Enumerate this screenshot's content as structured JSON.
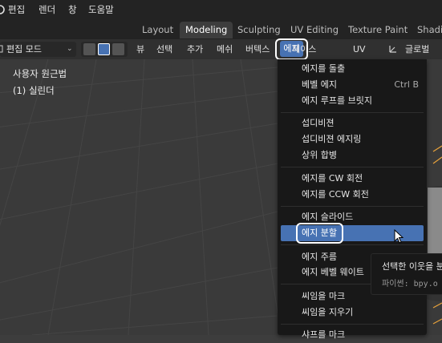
{
  "top_menu": {
    "items": [
      "편집",
      "렌더",
      "창",
      "도움말"
    ]
  },
  "workspaces": {
    "tabs": [
      {
        "label": "Layout",
        "active": false
      },
      {
        "label": "Modeling",
        "active": true
      },
      {
        "label": "Sculpting",
        "active": false
      },
      {
        "label": "UV Editing",
        "active": false
      },
      {
        "label": "Texture Paint",
        "active": false
      },
      {
        "label": "Shadin",
        "active": false
      }
    ]
  },
  "header": {
    "mode_label": "편집 모드",
    "menus": [
      "뷰",
      "선택",
      "추가",
      "메쉬",
      "버텍스",
      "에지",
      "페이스",
      "UV"
    ],
    "active_menu": "에지",
    "orientation_label": "글로벌"
  },
  "viewport": {
    "view_name": "사용자 원근법",
    "object_name": "(1) 실린더"
  },
  "edge_menu": {
    "groups": [
      [
        {
          "label": "에지를 돌출",
          "shortcut": ""
        },
        {
          "label": "베벨 에지",
          "shortcut": "Ctrl B"
        },
        {
          "label": "에지 루프를 브릿지",
          "shortcut": ""
        }
      ],
      [
        {
          "label": "섭디비젼",
          "shortcut": ""
        },
        {
          "label": "섭디비젼 에지링",
          "shortcut": ""
        },
        {
          "label": "상위 합병",
          "shortcut": ""
        }
      ],
      [
        {
          "label": "에지를 CW 회전",
          "shortcut": ""
        },
        {
          "label": "에지를 CCW 회전",
          "shortcut": ""
        }
      ],
      [
        {
          "label": "에지 슬라이드",
          "shortcut": ""
        },
        {
          "label": "에지 분할",
          "shortcut": "",
          "highlighted": true
        }
      ],
      [
        {
          "label": "에지 주름",
          "shortcut": ""
        },
        {
          "label": "에지 베벨 웨이트",
          "shortcut": ""
        }
      ],
      [
        {
          "label": "씨임을 마크",
          "shortcut": ""
        },
        {
          "label": "씨임을 지우기",
          "shortcut": ""
        }
      ],
      [
        {
          "label": "샤프를 마크",
          "shortcut": ""
        }
      ]
    ]
  },
  "tooltip": {
    "description": "선택한 이웃을 분",
    "python": "파이썬: bpy.o"
  },
  "colors": {
    "accent": "#4772b3",
    "menu_bg": "#181818",
    "viewport_bg": "#3a3a3a"
  }
}
